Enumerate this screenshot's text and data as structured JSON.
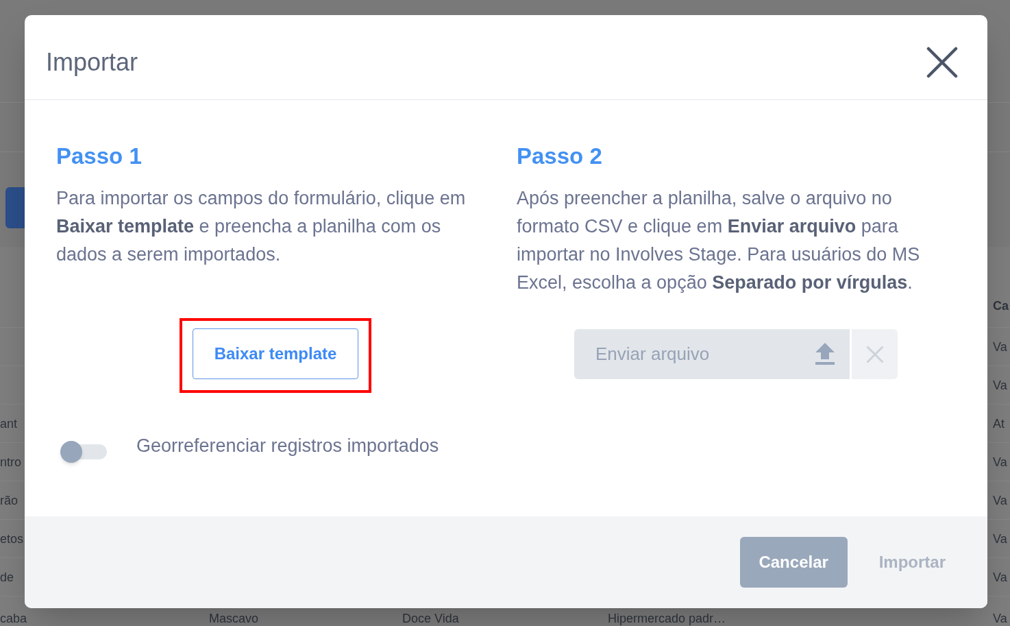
{
  "background_page": {
    "header": {
      "column_5": "Ca"
    },
    "rows": [
      {
        "column_5": "Va"
      },
      {
        "column_5": "Va"
      },
      {
        "column_1": "ant",
        "column_5": "At"
      },
      {
        "column_1": "ntro",
        "column_5": "Va"
      },
      {
        "column_1": "rão",
        "column_5": "Va"
      },
      {
        "column_1": "etos",
        "column_5": "Va"
      },
      {
        "column_1": "de",
        "column_5": "Va"
      },
      {
        "column_1": "caba",
        "column_2": "Mascavo",
        "column_3": "Doce Vida",
        "column_4": "Hipermercado padr…",
        "column_5": "Va"
      }
    ]
  },
  "dialog": {
    "title": "Importar",
    "steps": [
      {
        "kind": "download",
        "title": "Passo 1",
        "text": "Para importar os campos do formulário, clique em **Baixar template** e preencha a planilha com os dados a serem importados.",
        "button": {
          "label": "Baixar template",
          "highlighted": true
        }
      },
      {
        "kind": "upload",
        "title": "Passo 2",
        "text": "Após preencher a planilha, salve o arquivo no formato CSV e clique em **Enviar arquivo** para importar no Involves Stage. Para usuários do MS Excel, escolha a opção **Separado por vírgulas**.",
        "file_field": {
          "placeholder": "Enviar arquivo"
        }
      }
    ],
    "toggle": {
      "label": "Georreferenciar registros importados",
      "on": false
    },
    "buttons": [
      {
        "kind": "secondary",
        "label": "Cancelar",
        "disabled": false
      },
      {
        "kind": "primary",
        "label": "Importar",
        "disabled": true
      }
    ]
  }
}
